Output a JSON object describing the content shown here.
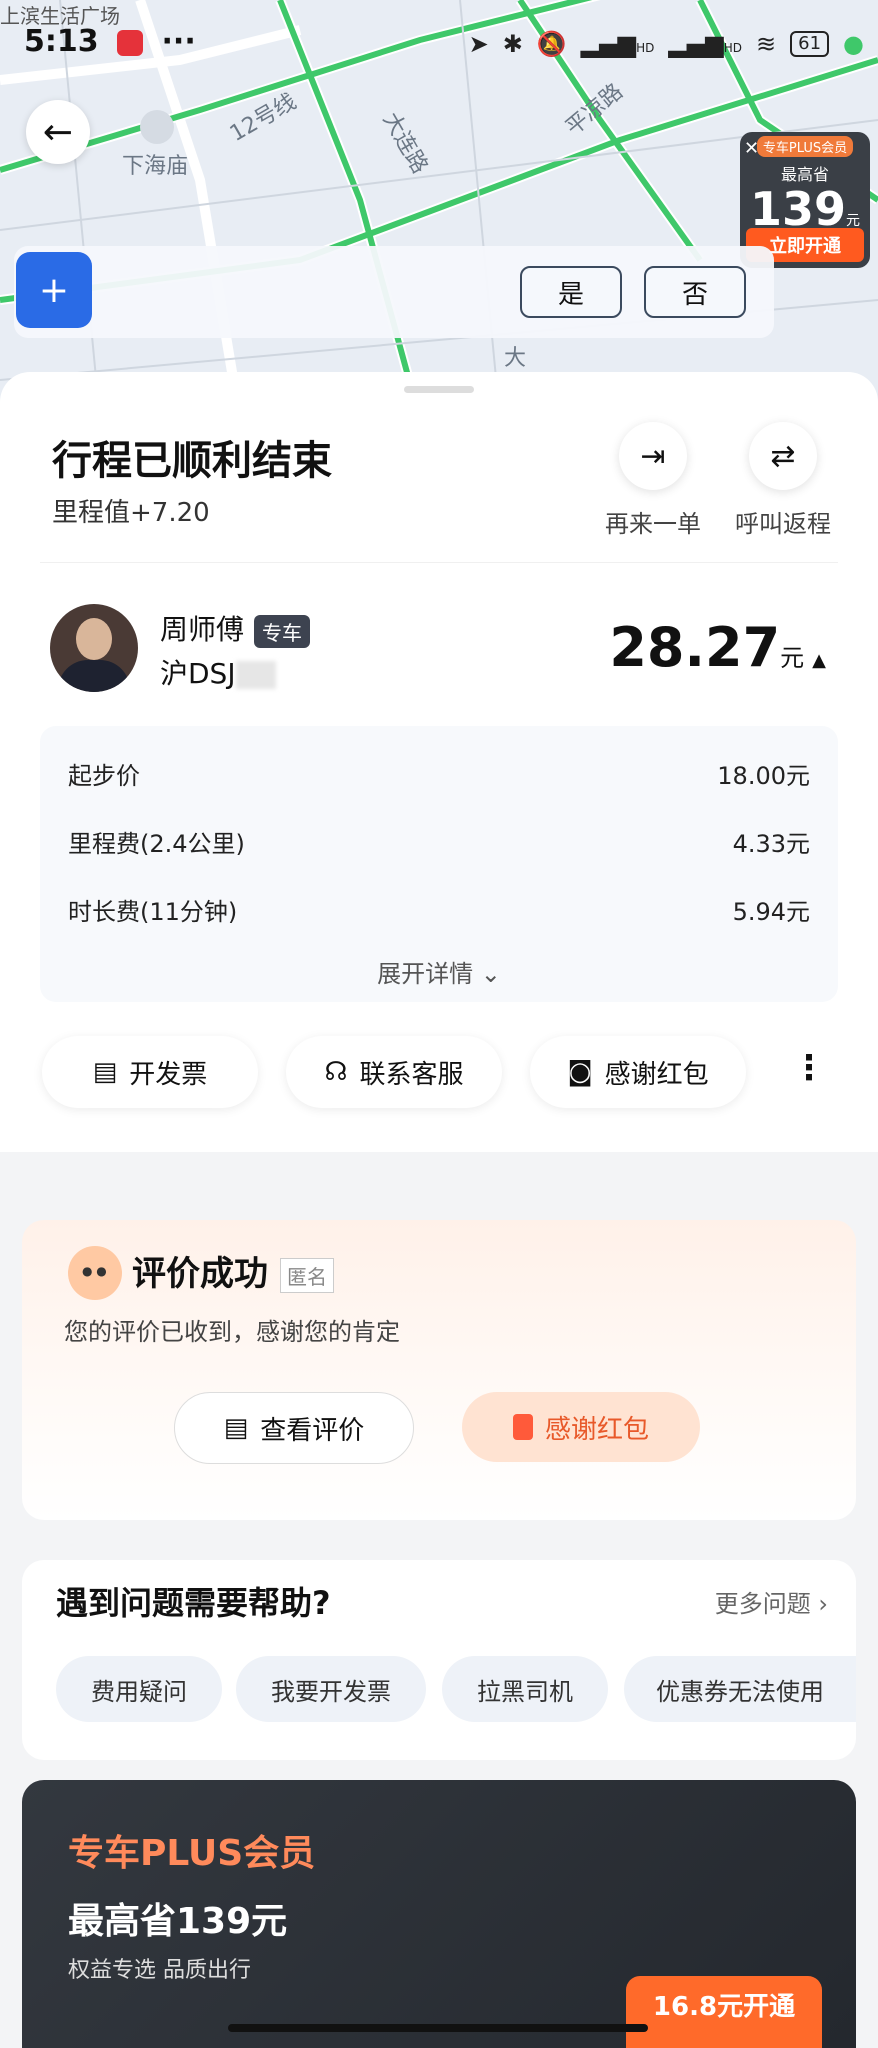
{
  "status_bar": {
    "carrier_top": "上滨生活广场",
    "time": "5:13",
    "dots": "···",
    "battery": "61",
    "signal1": "HD",
    "signal2": "HD"
  },
  "map": {
    "labels": [
      "下海庙",
      "大连路",
      "平凉路",
      "大"
    ],
    "road_label": "12号线"
  },
  "promo": {
    "tag": "专车PLUS会员",
    "max_label": "最高省",
    "amount": "139",
    "unit": "元",
    "button": "立即开通"
  },
  "safety": {
    "yes": "是",
    "no": "否"
  },
  "trip": {
    "title": "行程已顺利结束",
    "mileage": "里程值+7.20",
    "actions": [
      {
        "label": "再来一单"
      },
      {
        "label": "呼叫返程"
      }
    ],
    "driver_name": "周师傅",
    "car_type": "专车",
    "plate": "沪DSJ",
    "price": "28.27",
    "price_unit": "元",
    "fares": [
      {
        "label": "起步价",
        "value": "18.00元"
      },
      {
        "label": "里程费(2.4公里)",
        "value": "4.33元"
      },
      {
        "label": "时长费(11分钟)",
        "value": "5.94元"
      }
    ],
    "expand": "展开详情",
    "chips": [
      {
        "label": "开发票"
      },
      {
        "label": "联系客服"
      },
      {
        "label": "感谢红包"
      }
    ]
  },
  "review": {
    "title": "评价成功",
    "anon": "匿名",
    "subtitle": "您的评价已收到，感谢您的肯定",
    "view": "查看评价",
    "tip": "感谢红包"
  },
  "help": {
    "title": "遇到问题需要帮助?",
    "more": "更多问题",
    "chips": [
      "费用疑问",
      "我要开发票",
      "拉黑司机",
      "优惠券无法使用"
    ]
  },
  "plus": {
    "title": "专车PLUS会员",
    "main": "最高省139元",
    "sub": "权益专选 品质出行",
    "button": "16.8元开通"
  }
}
